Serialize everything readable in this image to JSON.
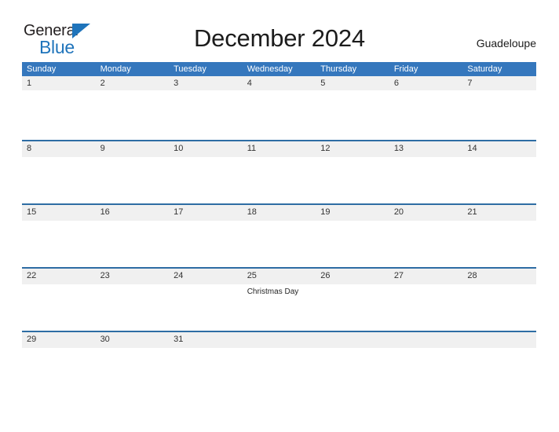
{
  "branding": {
    "logo_word_one": "General",
    "logo_word_two": "Blue",
    "flag_icon": "blue-triangle-flag-icon"
  },
  "header": {
    "title": "December 2024",
    "location": "Guadeloupe"
  },
  "colors": {
    "header_blue": "#3577bd",
    "rule_blue": "#2e6da4",
    "date_band_gray": "#f0f0f0",
    "logo_blue": "#1f74bb",
    "page_background": "#ffffff",
    "text_dark": "#1c1c1c"
  },
  "calendar": {
    "month": "December",
    "year": "2024",
    "day_headers": [
      "Sunday",
      "Monday",
      "Tuesday",
      "Wednesday",
      "Thursday",
      "Friday",
      "Saturday"
    ],
    "weeks": [
      {
        "days": [
          {
            "number": "1",
            "events": []
          },
          {
            "number": "2",
            "events": []
          },
          {
            "number": "3",
            "events": []
          },
          {
            "number": "4",
            "events": []
          },
          {
            "number": "5",
            "events": []
          },
          {
            "number": "6",
            "events": []
          },
          {
            "number": "7",
            "events": []
          }
        ]
      },
      {
        "days": [
          {
            "number": "8",
            "events": []
          },
          {
            "number": "9",
            "events": []
          },
          {
            "number": "10",
            "events": []
          },
          {
            "number": "11",
            "events": []
          },
          {
            "number": "12",
            "events": []
          },
          {
            "number": "13",
            "events": []
          },
          {
            "number": "14",
            "events": []
          }
        ]
      },
      {
        "days": [
          {
            "number": "15",
            "events": []
          },
          {
            "number": "16",
            "events": []
          },
          {
            "number": "17",
            "events": []
          },
          {
            "number": "18",
            "events": []
          },
          {
            "number": "19",
            "events": []
          },
          {
            "number": "20",
            "events": []
          },
          {
            "number": "21",
            "events": []
          }
        ]
      },
      {
        "days": [
          {
            "number": "22",
            "events": []
          },
          {
            "number": "23",
            "events": []
          },
          {
            "number": "24",
            "events": []
          },
          {
            "number": "25",
            "events": [
              "Christmas Day"
            ]
          },
          {
            "number": "26",
            "events": []
          },
          {
            "number": "27",
            "events": []
          },
          {
            "number": "28",
            "events": []
          }
        ]
      },
      {
        "days": [
          {
            "number": "29",
            "events": []
          },
          {
            "number": "30",
            "events": []
          },
          {
            "number": "31",
            "events": []
          },
          {
            "number": "",
            "events": []
          },
          {
            "number": "",
            "events": []
          },
          {
            "number": "",
            "events": []
          },
          {
            "number": "",
            "events": []
          }
        ]
      }
    ]
  }
}
